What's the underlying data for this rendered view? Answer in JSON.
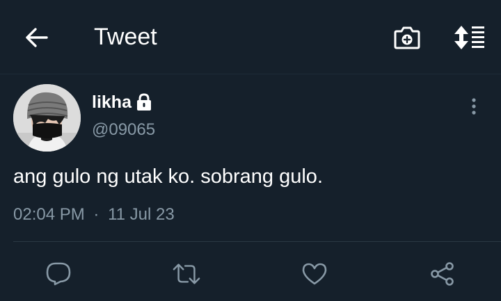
{
  "header": {
    "title": "Tweet",
    "back_icon": "arrow-left-icon",
    "camera_icon": "camera-plus-icon",
    "sort_icon": "sort-order-icon"
  },
  "tweet": {
    "display_name": "likha",
    "handle": "@09065",
    "protected_icon": "lock-icon",
    "text": "ang gulo ng utak ko. sobrang gulo.",
    "time": "02:04 PM",
    "separator": "·",
    "date": "11 Jul 23"
  },
  "actions": {
    "reply_icon": "reply-icon",
    "retweet_icon": "retweet-icon",
    "like_icon": "heart-icon",
    "share_icon": "share-icon"
  },
  "colors": {
    "background": "#15202b",
    "text_primary": "#ffffff",
    "text_secondary": "#8899a6",
    "divider": "#2b3944"
  }
}
